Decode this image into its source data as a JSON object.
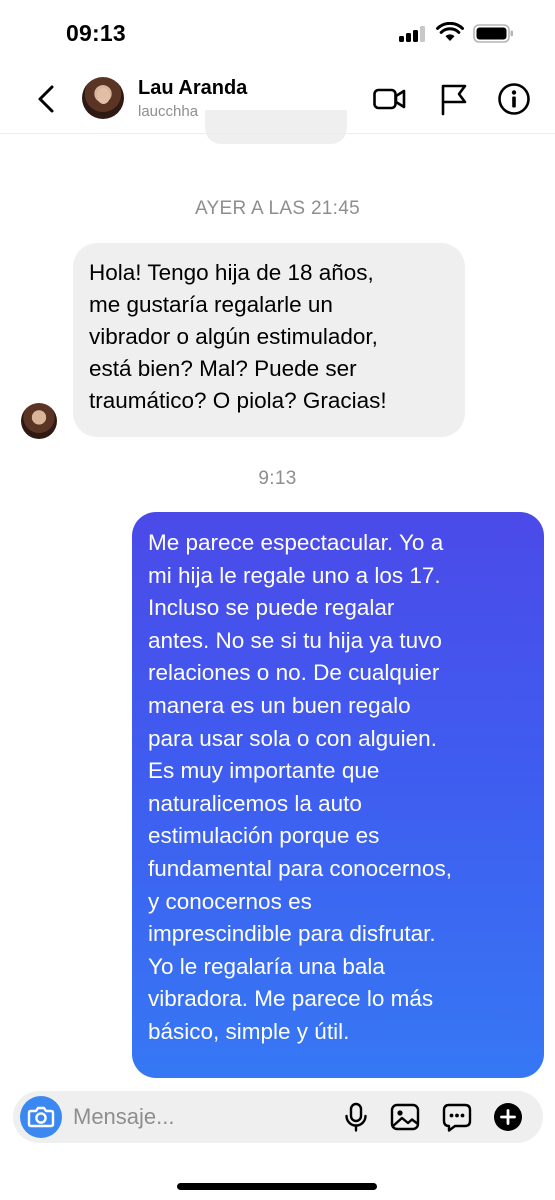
{
  "status_bar": {
    "time": "09:13",
    "icons": [
      "cellular-signal-icon",
      "wifi-icon",
      "battery-icon"
    ]
  },
  "header": {
    "contact_name": "Lau Aranda",
    "contact_handle": "laucchha",
    "icons": [
      "back-chevron-icon",
      "video-call-icon",
      "flag-icon",
      "info-icon"
    ]
  },
  "chat": {
    "timestamp_1": "AYER A LAS 21:45",
    "incoming_message": "Hola! Tengo hija de 18 años,\nme gustaría regalarle un\nvibrador o algún estimulador,\nestá bien? Mal? Puede ser\ntraumático? O piola? Gracias!",
    "timestamp_2": "9:13",
    "outgoing_message": "Me parece espectacular. Yo a\nmi hija le regale uno a los 17.\nIncluso se puede regalar\nantes. No se si tu hija ya tuvo\nrelaciones o no. De cualquier\nmanera es un buen regalo\npara usar sola o con alguien.\nEs muy importante que\nnaturalicemos la auto\nestimulación porque es\nfundamental para conocernos,\ny conocernos es\nimprescindible para disfrutar.\nYo le regalaría una bala\nvibradora. Me parece lo más\nbásico, simple y útil."
  },
  "composer": {
    "placeholder": "Mensaje...",
    "value": "",
    "icons": [
      "camera-icon",
      "microphone-icon",
      "gallery-icon",
      "sticker-icon",
      "plus-icon"
    ]
  },
  "colors": {
    "outgoing_gradient_top": "#4b4ae8",
    "outgoing_gradient_bottom": "#3678f4",
    "incoming_bubble": "#efefef",
    "camera_button": "#3a88f0",
    "secondary_text": "#8e8e8e"
  }
}
